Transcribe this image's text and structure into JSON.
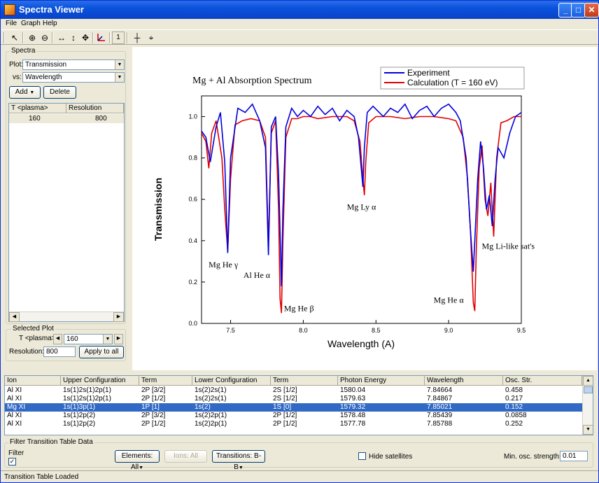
{
  "window": {
    "title": "Spectra Viewer"
  },
  "menu": [
    "File",
    "Graph",
    "Help"
  ],
  "toolbar": {
    "zoom_one_label": "1"
  },
  "spectra": {
    "group_label": "Spectra",
    "plot_label": "Plot:",
    "plot_value": "Transmission",
    "vs_label": "vs:",
    "vs_value": "Wavelength",
    "add_label": "Add",
    "delete_label": "Delete",
    "columns": [
      "T <plasma>",
      "Resolution"
    ],
    "rows": [
      [
        "160",
        "800"
      ]
    ]
  },
  "selected_plot": {
    "group_label": "Selected Plot",
    "t_label": "T <plasma>",
    "t_value": "160",
    "resolution_label": "Resolution:",
    "resolution_value": "800",
    "apply_label": "Apply to all"
  },
  "chart_data": {
    "type": "line",
    "title": "Mg + Al Absorption Spectrum",
    "xlabel": "Wavelength (A)",
    "ylabel": "Transmission",
    "xlim": [
      7.3,
      9.5
    ],
    "ylim": [
      0.0,
      1.1
    ],
    "xticks": [
      "7.5",
      "8.0",
      "8.5",
      "9.0",
      "9.5"
    ],
    "yticks": [
      "0.0",
      "0.2",
      "0.4",
      "0.6",
      "0.8",
      "1.0"
    ],
    "legend": {
      "placement": "top-right",
      "entries": [
        "Experiment",
        "Calculation (T = 160 eV)"
      ]
    },
    "series": [
      {
        "name": "Experiment",
        "color": "#0000dd",
        "x": [
          7.3,
          7.33,
          7.36,
          7.4,
          7.43,
          7.46,
          7.48,
          7.5,
          7.55,
          7.6,
          7.65,
          7.7,
          7.74,
          7.76,
          7.78,
          7.81,
          7.83,
          7.85,
          7.86,
          7.88,
          7.92,
          7.96,
          8.0,
          8.05,
          8.1,
          8.15,
          8.2,
          8.25,
          8.3,
          8.35,
          8.38,
          8.41,
          8.42,
          8.44,
          8.48,
          8.55,
          8.6,
          8.65,
          8.7,
          8.75,
          8.8,
          8.85,
          8.9,
          8.95,
          9.0,
          9.05,
          9.08,
          9.12,
          9.15,
          9.17,
          9.18,
          9.2,
          9.22,
          9.24,
          9.26,
          9.28,
          9.3,
          9.32,
          9.34,
          9.38,
          9.42,
          9.46,
          9.5
        ],
        "y": [
          0.93,
          0.9,
          0.78,
          0.95,
          1.02,
          0.78,
          0.34,
          0.8,
          1.04,
          1.02,
          1.06,
          0.98,
          0.85,
          0.33,
          0.95,
          1.0,
          0.72,
          0.18,
          0.55,
          0.95,
          1.04,
          1.0,
          1.03,
          1.0,
          1.05,
          1.01,
          1.04,
          0.98,
          1.03,
          1.0,
          0.9,
          0.66,
          0.85,
          1.02,
          1.05,
          1.0,
          1.04,
          1.02,
          1.06,
          0.99,
          1.03,
          1.05,
          1.0,
          1.04,
          1.06,
          1.02,
          0.98,
          0.8,
          0.45,
          0.25,
          0.4,
          0.7,
          0.88,
          0.75,
          0.55,
          0.62,
          0.47,
          0.7,
          0.85,
          0.8,
          0.92,
          1.0,
          1.02
        ]
      },
      {
        "name": "Calculation (T = 160 eV)",
        "color": "#e00000",
        "x": [
          7.3,
          7.33,
          7.35,
          7.37,
          7.4,
          7.44,
          7.46,
          7.48,
          7.5,
          7.53,
          7.58,
          7.64,
          7.7,
          7.74,
          7.76,
          7.78,
          7.81,
          7.83,
          7.84,
          7.85,
          7.86,
          7.88,
          7.92,
          7.96,
          8.0,
          8.05,
          8.1,
          8.2,
          8.3,
          8.35,
          8.39,
          8.41,
          8.42,
          8.43,
          8.45,
          8.5,
          8.6,
          8.7,
          8.8,
          8.9,
          9.0,
          9.05,
          9.1,
          9.13,
          9.15,
          9.17,
          9.18,
          9.19,
          9.21,
          9.23,
          9.25,
          9.27,
          9.29,
          9.31,
          9.33,
          9.36,
          9.4,
          9.45,
          9.5
        ],
        "y": [
          0.92,
          0.88,
          0.75,
          0.92,
          0.98,
          0.8,
          0.55,
          0.35,
          0.7,
          0.96,
          0.98,
          0.99,
          0.98,
          0.9,
          0.38,
          0.92,
          0.98,
          0.55,
          0.12,
          0.05,
          0.4,
          0.9,
          0.99,
          0.99,
          1.0,
          1.0,
          0.99,
          1.0,
          1.0,
          0.98,
          0.88,
          0.7,
          0.62,
          0.78,
          0.97,
          1.0,
          1.0,
          0.99,
          1.0,
          1.0,
          0.99,
          0.98,
          0.9,
          0.7,
          0.45,
          0.1,
          0.06,
          0.35,
          0.75,
          0.86,
          0.6,
          0.52,
          0.68,
          0.42,
          0.8,
          0.97,
          0.98,
          1.0,
          1.0
        ]
      }
    ],
    "annotations": [
      {
        "text": "Mg He γ",
        "x": 7.45,
        "y": 0.27
      },
      {
        "text": "Al He α",
        "x": 7.68,
        "y": 0.22
      },
      {
        "text": "Mg He β",
        "x": 7.97,
        "y": 0.06
      },
      {
        "text": "Mg Ly α",
        "x": 8.4,
        "y": 0.55
      },
      {
        "text": "Mg He α",
        "x": 9.0,
        "y": 0.1
      },
      {
        "text": "Mg Li-like sat's",
        "x": 9.41,
        "y": 0.36
      }
    ]
  },
  "transitions": {
    "columns": [
      "Ion",
      "Upper Configuration",
      "Term",
      "Lower Configuration",
      "Term",
      "Photon Energy",
      "Wavelength",
      "Osc. Str."
    ],
    "rows": [
      [
        "Al XI",
        "1s(1)2s(1)2p(1)",
        "2P [3/2]",
        "1s(2)2s(1)",
        "2S [1/2]",
        "1580.04",
        "7.84664",
        "0.458"
      ],
      [
        "Al XI",
        "1s(1)2s(1)2p(1)",
        "2P [1/2]",
        "1s(2)2s(1)",
        "2S [1/2]",
        "1579.63",
        "7.84867",
        "0.217"
      ],
      [
        "Mg XI",
        "1s(1)3p(1)",
        "1P [1]",
        "1s(2)",
        "1S [0]",
        "1579.32",
        "7.85021",
        "0.152"
      ],
      [
        "Al XI",
        "1s(1)2p(2)",
        "2P [3/2]",
        "1s(2)2p(1)",
        "2P [1/2]",
        "1578.48",
        "7.85439",
        "0.0858"
      ],
      [
        "Al XI",
        "1s(1)2p(2)",
        "2P [1/2]",
        "1s(2)2p(1)",
        "2P [1/2]",
        "1577.78",
        "7.85788",
        "0.252"
      ]
    ],
    "selected_row": 2
  },
  "filter": {
    "group_label": "Filter Transition Table Data",
    "filter_label": "Filter",
    "filter_checked": "✓",
    "elements_label": "Elements: All",
    "ions_label": "Ions: All",
    "transitions_label": "Transitions: B-B",
    "hide_satellites_label": "Hide satellites",
    "min_osc_label": "Min. osc. strength:",
    "min_osc_value": "0.01"
  },
  "status": {
    "text": "Transition Table Loaded"
  }
}
